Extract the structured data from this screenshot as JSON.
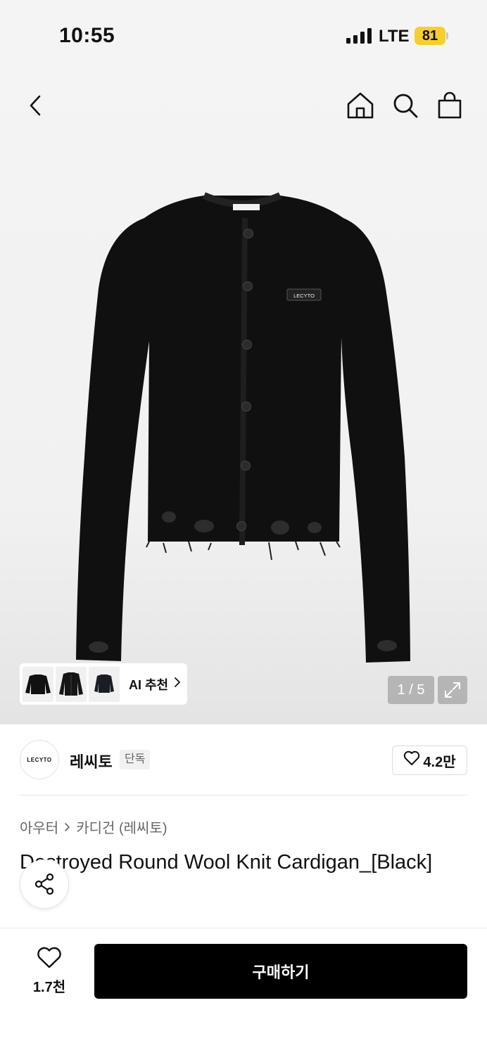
{
  "status_bar": {
    "time": "10:55",
    "network": "LTE",
    "battery": "81"
  },
  "gallery": {
    "ai_recommend_label": "AI 추천",
    "counter": "1 / 5",
    "garment_label_text": "LECYTO"
  },
  "brand": {
    "logo_text": "LECYTO",
    "name": "레씨토",
    "badge": "단독",
    "like_count": "4.2만"
  },
  "breadcrumb": {
    "items": [
      "아우터",
      "카디건 (레씨토)"
    ]
  },
  "product": {
    "title": "Destroyed Round Wool Knit Cardigan_[Black]"
  },
  "bottom_bar": {
    "wish_count": "1.7천",
    "buy_label": "구매하기"
  },
  "icons": {
    "back": "chevron-left-icon",
    "home": "home-icon",
    "search": "search-icon",
    "cart": "shopping-bag-icon",
    "expand": "expand-icon",
    "share": "share-icon",
    "heart": "heart-icon"
  },
  "colors": {
    "battery": "#f5cf2e",
    "buy_button": "#000000"
  }
}
